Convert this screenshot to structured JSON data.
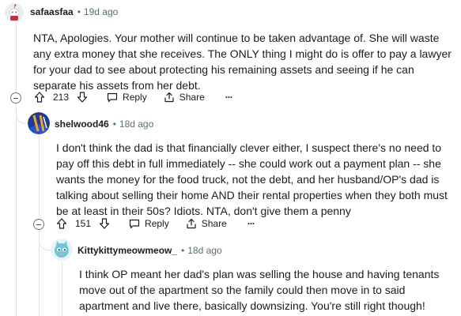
{
  "comments": [
    {
      "username": "safaasfaa",
      "time": "19d ago",
      "body": "NTA, Apologies. Your mother will continue to be taken advantage of. She will waste any extra money that she receives. The ONLY thing I might do is offer to pay a lawyer for your dad to see about protecting his remaining assets and seeing if he can separate his assets from her debt.",
      "score": "213",
      "reply_label": "Reply",
      "share_label": "Share",
      "more_label": "···"
    },
    {
      "username": "shelwood46",
      "time": "18d ago",
      "body": "I don't think the dad is that financially clever either, I suspect there's no need to pay off this debt in full immediately -- she could work out a payment plan -- she wants the money for the food truck, not the debt, and her husband/OP's dad is talking about selling their home AND their rental properties when they both must be at least in their 50s? Idiots. NTA, don't give them a penny",
      "score": "151",
      "reply_label": "Reply",
      "share_label": "Share",
      "more_label": "···"
    },
    {
      "username": "Kittykittymeowmeow_",
      "time": "18d ago",
      "body": "I think OP meant her dad's plan was selling the house and having tenants move out of the apartment so the family could then move in to said apartment and live there, basically downsizing. You're still right though!"
    }
  ],
  "colors": {
    "thread": "#dfe3e5",
    "meta_gray": "#576f76",
    "text": "#1c1c1c"
  }
}
